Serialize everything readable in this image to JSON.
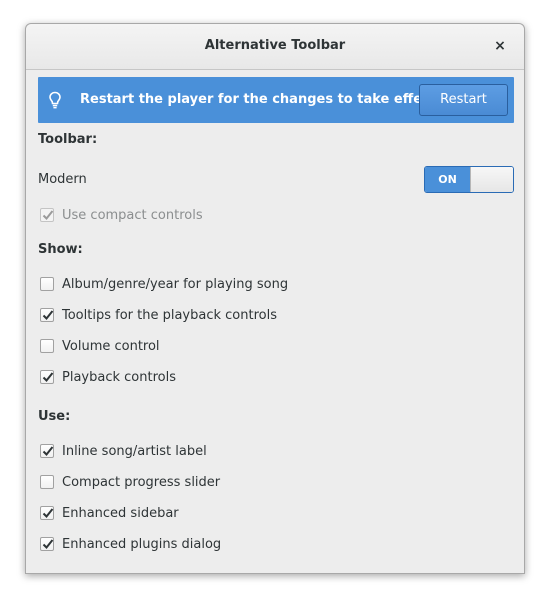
{
  "window": {
    "title": "Alternative Toolbar",
    "close_label": "×"
  },
  "infobar": {
    "message": "Restart the player for the changes to take effect.",
    "restart_label": "Restart",
    "icon": "lightbulb-icon",
    "color": "#4a90d9"
  },
  "toolbar_section": {
    "header": "Toolbar:",
    "style_label": "Modern",
    "switch_label": "ON",
    "switch_state": true,
    "compact_controls": {
      "label": "Use compact controls",
      "checked": true,
      "enabled": false
    }
  },
  "show_section": {
    "header": "Show:",
    "items": [
      {
        "label": "Album/genre/year for playing song",
        "checked": false
      },
      {
        "label": "Tooltips for the playback controls",
        "checked": true
      },
      {
        "label": "Volume control",
        "checked": false
      },
      {
        "label": "Playback controls",
        "checked": true
      }
    ]
  },
  "use_section": {
    "header": "Use:",
    "items": [
      {
        "label": "Inline song/artist label",
        "checked": true
      },
      {
        "label": "Compact progress slider",
        "checked": false
      },
      {
        "label": "Enhanced sidebar",
        "checked": true
      },
      {
        "label": "Enhanced plugins dialog",
        "checked": true
      }
    ]
  }
}
